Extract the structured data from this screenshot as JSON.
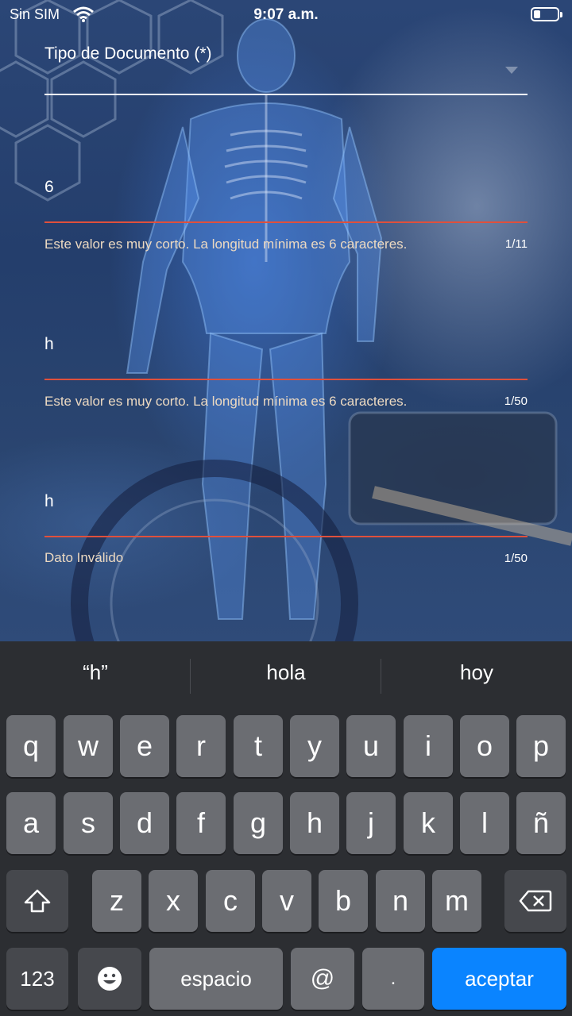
{
  "status_bar": {
    "carrier": "Sin SIM",
    "time": "9:07 a.m."
  },
  "form": {
    "document_type": {
      "label": "Tipo de Documento (*)"
    },
    "field1": {
      "value": "6",
      "helper": "Este valor es muy corto. La longitud mínima es 6 caracteres.",
      "counter": "1/11",
      "state": "error"
    },
    "field2": {
      "value": "h",
      "helper": "Este valor es muy corto. La longitud mínima es 6 caracteres.",
      "counter": "1/50",
      "state": "error"
    },
    "field3": {
      "value": "h",
      "helper": "Dato Inválido",
      "counter": "1/50",
      "state": "error"
    }
  },
  "colors": {
    "error_line": "#e0503c",
    "active_line": "#ffffff",
    "helper_text": "#ecd9c1",
    "keyboard_bg": "#2c2e32",
    "accept_key": "#0a84ff"
  },
  "keyboard": {
    "suggestions": [
      "“h”",
      "hola",
      "hoy"
    ],
    "row1": [
      "q",
      "w",
      "e",
      "r",
      "t",
      "y",
      "u",
      "i",
      "o",
      "p"
    ],
    "row2": [
      "a",
      "s",
      "d",
      "f",
      "g",
      "h",
      "j",
      "k",
      "l",
      "ñ"
    ],
    "row3": [
      "z",
      "x",
      "c",
      "v",
      "b",
      "n",
      "m"
    ],
    "shift_icon": "shift-icon",
    "delete_icon": "backspace-icon",
    "numbers_label": "123",
    "emoji_icon": "emoji-icon",
    "space_label": "espacio",
    "at_label": "@",
    "dot_label": ".",
    "accept_label": "aceptar"
  }
}
